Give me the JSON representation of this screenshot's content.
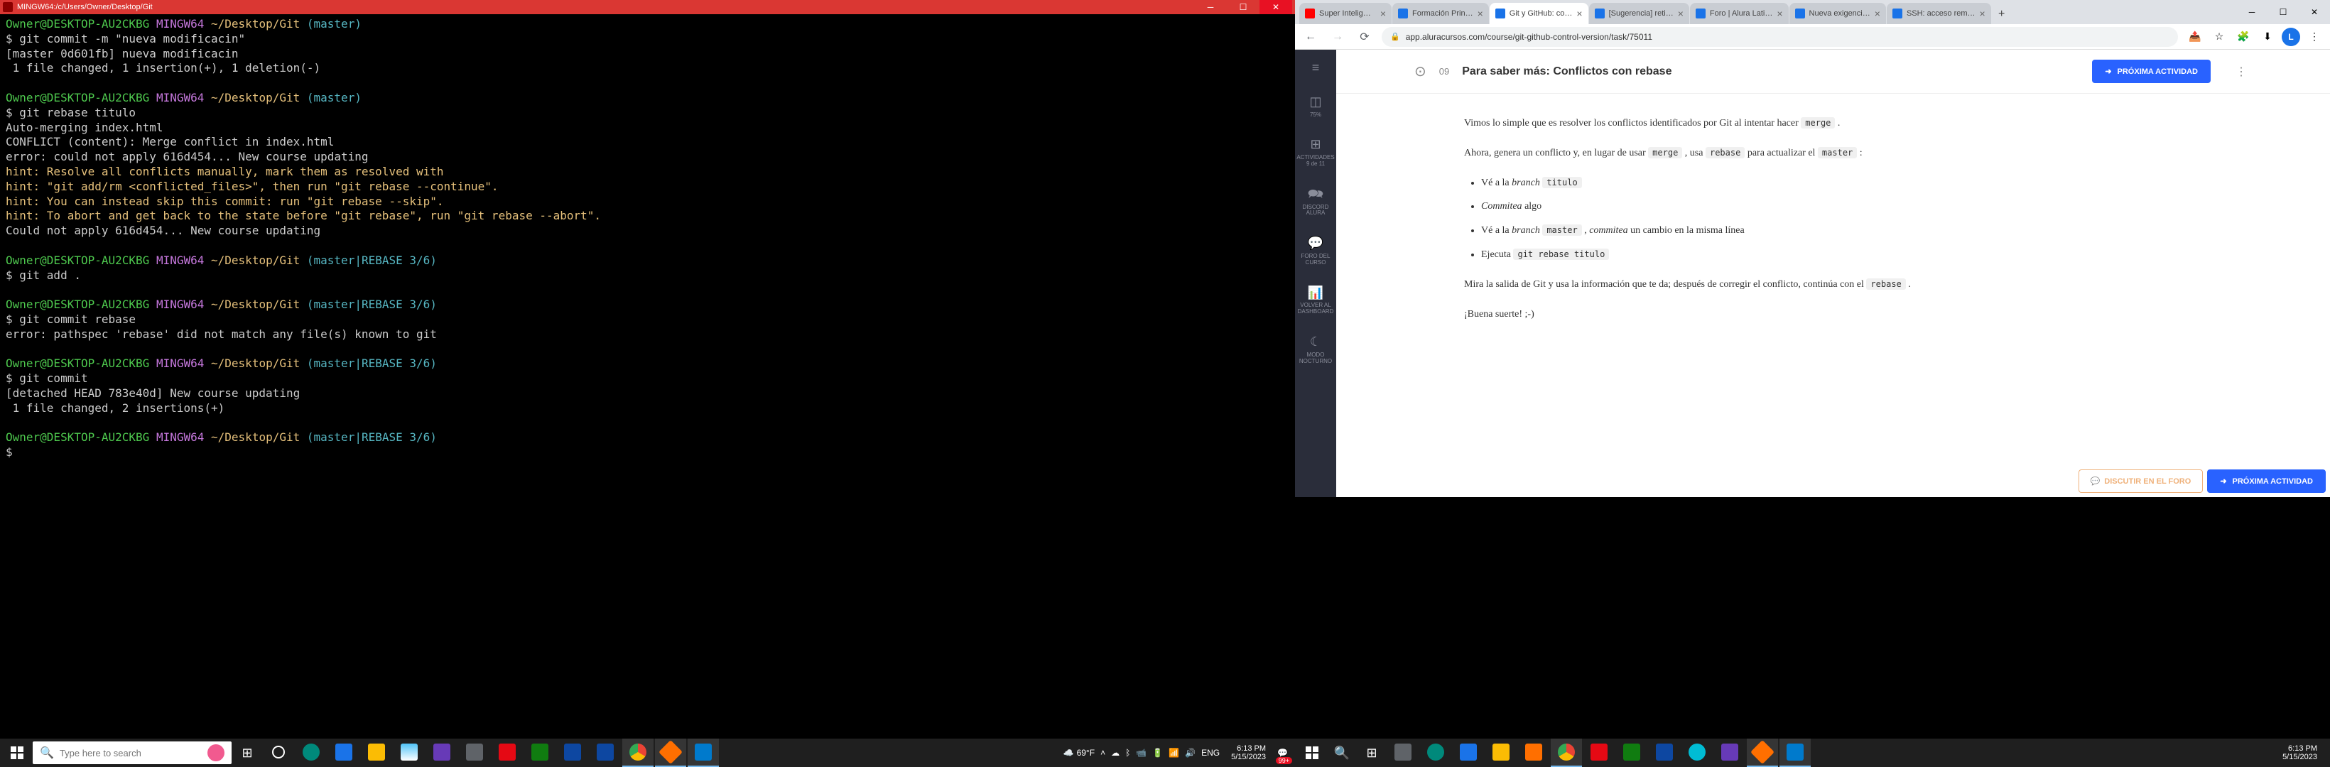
{
  "left": {
    "terminal_title": "MINGW64:/c/Users/Owner/Desktop/Git",
    "prompt_user": "Owner@DESKTOP-AU2CKBG",
    "prompt_env": "MINGW64",
    "prompt_path": "~/Desktop/Git",
    "branch_master": "(master)",
    "branch_rebase": "(master|REBASE 3/6)",
    "lines": {
      "cmd1": "$ git commit -m \"nueva modificacin\"",
      "out1a": "[master 0d601fb] nueva modificacin",
      "out1b": " 1 file changed, 1 insertion(+), 1 deletion(-)",
      "cmd2": "$ git rebase titulo",
      "out2a": "Auto-merging index.html",
      "out2b": "CONFLICT (content): Merge conflict in index.html",
      "out2c": "error: could not apply 616d454... New course updating",
      "hint1": "hint: Resolve all conflicts manually, mark them as resolved with",
      "hint2": "hint: \"git add/rm <conflicted_files>\", then run \"git rebase --continue\".",
      "hint3": "hint: You can instead skip this commit: run \"git rebase --skip\".",
      "hint4": "hint: To abort and get back to the state before \"git rebase\", run \"git rebase --abort\".",
      "out2d": "Could not apply 616d454... New course updating",
      "cmd3": "$ git add .",
      "cmd4": "$ git commit rebase",
      "out4a": "error: pathspec 'rebase' did not match any file(s) known to git",
      "cmd5": "$ git commit",
      "out5a": "[detached HEAD 783e40d] New course updating",
      "out5b": " 1 file changed, 2 insertions(+)",
      "cmd6": "$"
    },
    "taskbar": {
      "search_placeholder": "Type here to search",
      "weather": "69°F",
      "lang": "ENG",
      "time": "6:13 PM",
      "date": "5/15/2023"
    }
  },
  "right": {
    "tabs": [
      {
        "label": "Super Intelig…",
        "fav": "ic-red"
      },
      {
        "label": "Formación Prin…",
        "fav": "ic-blue"
      },
      {
        "label": "Git y GitHub: co…",
        "fav": "ic-blue",
        "active": true
      },
      {
        "label": "[Sugerencia] reti…",
        "fav": "ic-blue"
      },
      {
        "label": "Foro | Alura Lati…",
        "fav": "ic-blue"
      },
      {
        "label": "Nueva exigenci…",
        "fav": "ic-blue"
      },
      {
        "label": "SSH: acceso rem…",
        "fav": "ic-blue"
      }
    ],
    "url": "app.aluracursos.com/course/git-github-control-version/task/75011",
    "sidebar": {
      "menu": "≡",
      "items": [
        {
          "icon": "◫",
          "label": "75%"
        },
        {
          "icon": "⊞",
          "label": "ACTIVIDADES\n9 de 11"
        },
        {
          "icon": "🗪",
          "label": "DISCORD\nALURA"
        },
        {
          "icon": "💬",
          "label": "FORO DEL\nCURSO"
        },
        {
          "icon": "📊",
          "label": "VOLVER AL\nDASHBOARD"
        },
        {
          "icon": "☾",
          "label": "MODO\nNOCTURNO"
        }
      ]
    },
    "lesson": {
      "back_icon": "⊙",
      "num": "09",
      "title": "Para saber más: Conflictos con rebase",
      "next_btn": "PRÓXIMA ACTIVIDAD",
      "forum_btn": "DISCUTIR EN EL FORO"
    },
    "content": {
      "p1_a": "Vimos lo simple que es resolver los conflictos identificados por Git al intentar hacer ",
      "p1_code": "merge",
      "p1_b": " .",
      "p2_a": "Ahora, genera un conflicto y, en lugar de usar ",
      "p2_code1": "merge",
      "p2_b": " , usa ",
      "p2_code2": "rebase",
      "p2_c": " para actualizar el ",
      "p2_code3": "master",
      "p2_d": " :",
      "li1_a": "Vé a la ",
      "li1_em": "branch",
      "li1_code": "titulo",
      "li2_a": "Commitea",
      "li2_b": " algo",
      "li3_a": "Vé a la ",
      "li3_em": "branch",
      "li3_code": "master",
      "li3_b": " , ",
      "li3_em2": "commitea",
      "li3_c": " un cambio en la misma línea",
      "li4_a": "Ejecuta ",
      "li4_code": "git rebase titulo",
      "p3_a": "Mira la salida de Git y usa la información que te da; después de corregir el conflicto, continúa con el ",
      "p3_code": "rebase",
      "p3_b": " .",
      "p4": "¡Buena suerte! ;-)"
    },
    "taskbar": {
      "time": "6:13 PM",
      "date": "5/15/2023"
    }
  }
}
